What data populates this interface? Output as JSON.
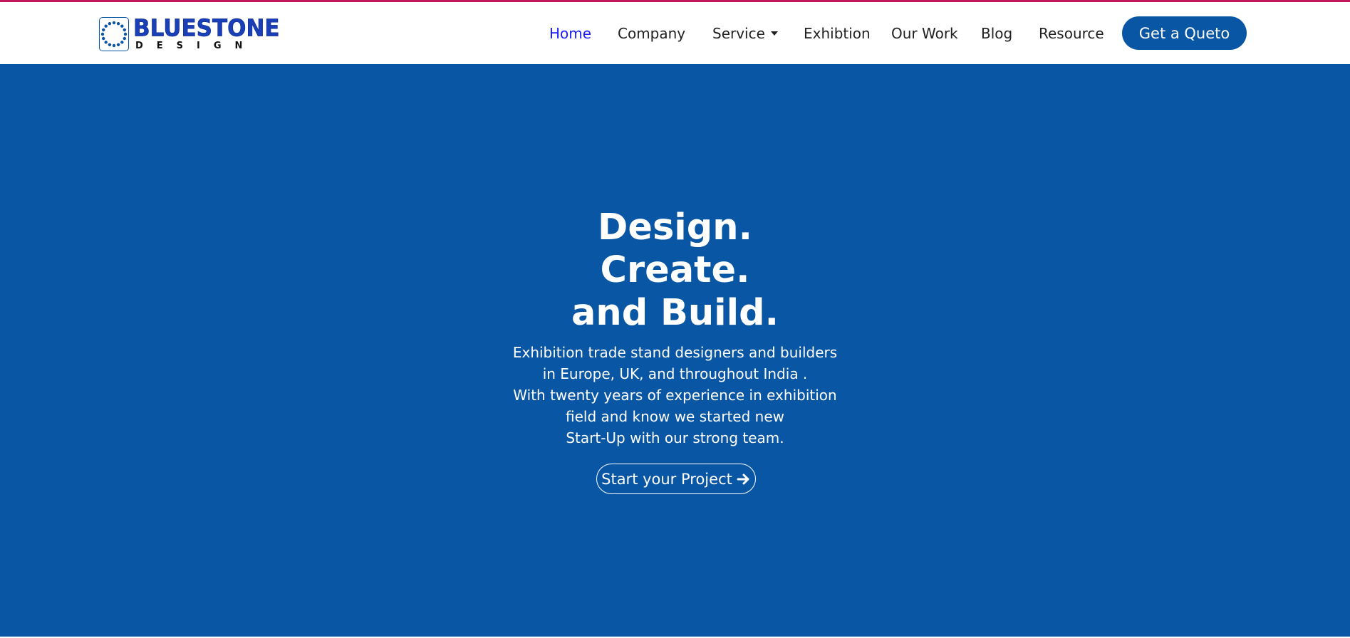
{
  "brand": {
    "name": "BLUESTONE",
    "subtitle": "DESIGN"
  },
  "colors": {
    "accent_top": "#c2185b",
    "primary": "#0956a5",
    "nav_active": "#1a1aff",
    "nav_text": "#1f1f1f"
  },
  "nav": {
    "items": [
      {
        "label": "Home",
        "active": true
      },
      {
        "label": "Company"
      },
      {
        "label": "Service",
        "has_dropdown": true
      },
      {
        "label": "Exhibtion"
      },
      {
        "label": "Our Work"
      },
      {
        "label": "Blog"
      },
      {
        "label": "Resource"
      }
    ],
    "cta_label": "Get a Queto"
  },
  "hero": {
    "title_lines": [
      "Design.",
      "Create.",
      "and Build."
    ],
    "description_lines": [
      "Exhibition trade stand designers and builders",
      "in Europe, UK, and throughout India .",
      "With twenty years of experience in exhibition",
      "field and know we started new",
      "Start-Up with our strong team."
    ],
    "cta_label": "Start your Project",
    "cta_icon": "arrow-right-icon"
  }
}
